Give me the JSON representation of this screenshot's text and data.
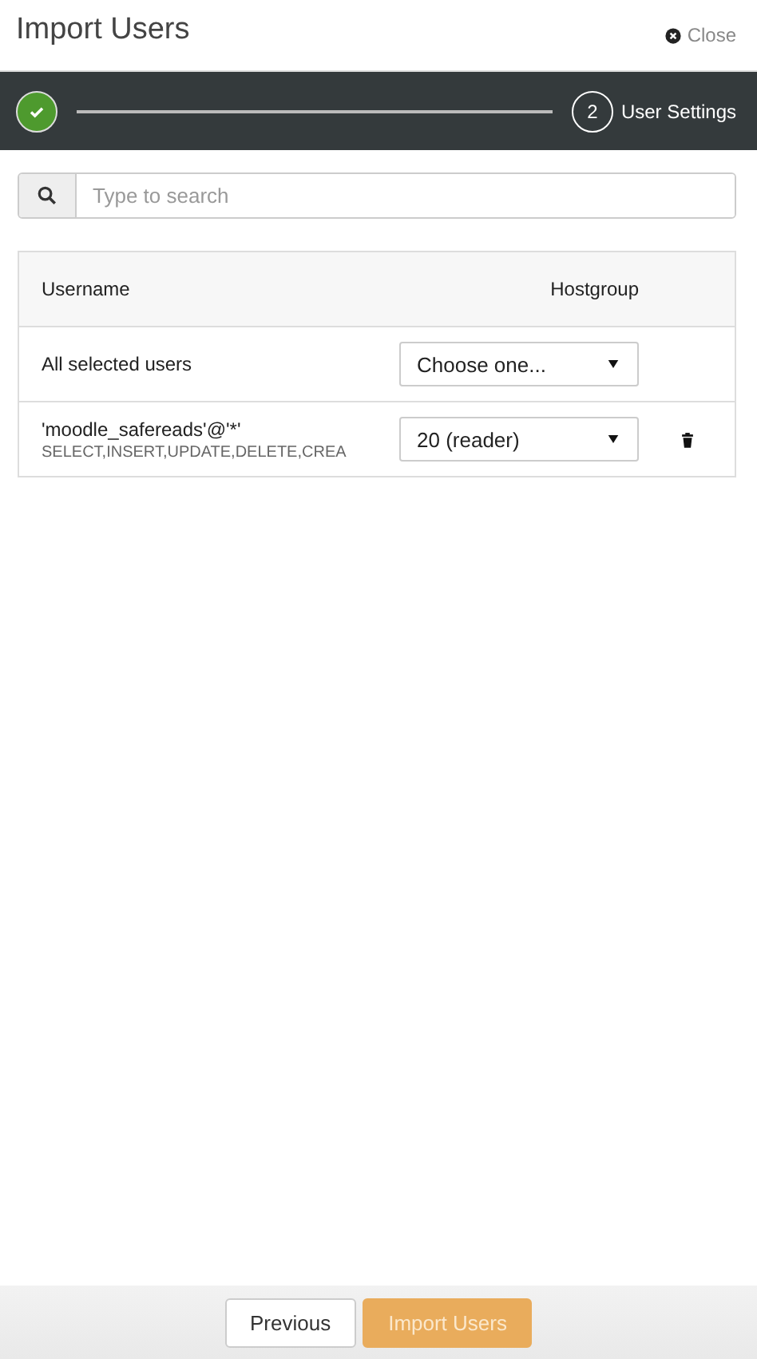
{
  "window": {
    "title": "Import Users",
    "close_label": "Close"
  },
  "steps": [
    {
      "done": true
    },
    {
      "label": "2",
      "title": "User Settings",
      "done": false
    }
  ],
  "search": {
    "placeholder": "Type to search"
  },
  "table": {
    "columns": [
      "Username",
      "Hostgroup"
    ],
    "rows": [
      {
        "name": "All selected users",
        "hostgroup": "Choose one...",
        "deletable": false
      },
      {
        "name": "'moodle_safereads'@'*'",
        "detail": "SELECT,INSERT,UPDATE,DELETE,CREA",
        "hostgroup": "20 (reader)",
        "deletable": true
      }
    ]
  },
  "buttons": [
    {
      "label": "Previous",
      "kind": "secondary",
      "disabled": false
    },
    {
      "label": "Import Users",
      "kind": "primary",
      "disabled": true
    }
  ]
}
